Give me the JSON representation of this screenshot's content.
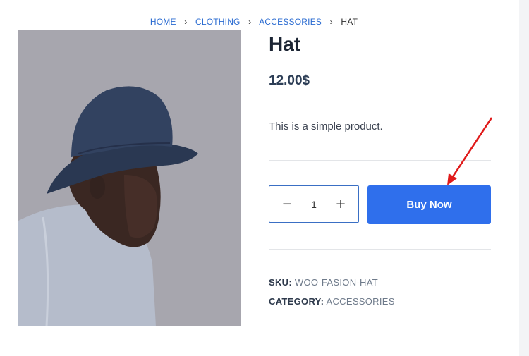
{
  "breadcrumb": {
    "items": [
      "HOME",
      "CLOTHING",
      "ACCESSORIES"
    ],
    "current": "HAT",
    "separator": "›"
  },
  "product": {
    "title": "Hat",
    "price": "12.00$",
    "description": "This is a simple product.",
    "quantity": "1",
    "buy_label": "Buy Now",
    "sku_label": "SKU:",
    "sku_value": "WOO-FASION-HAT",
    "category_label": "CATEGORY:",
    "category_value": "ACCESSORIES"
  },
  "colors": {
    "accent": "#2f6fec",
    "link": "#2a6bd1",
    "annotation_arrow": "#e01a1a"
  },
  "icons": {
    "minus": "minus-icon",
    "plus": "plus-icon",
    "separator": "chevron-right-icon"
  }
}
